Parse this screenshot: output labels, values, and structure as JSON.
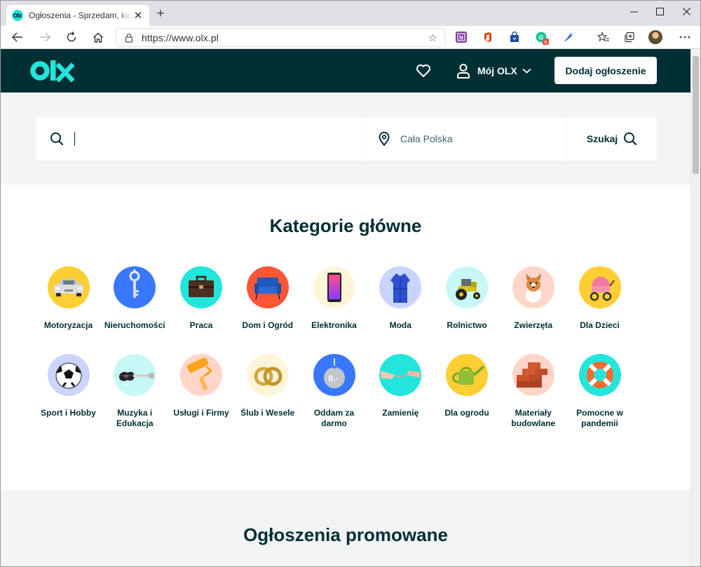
{
  "browser": {
    "tab_title": "Ogłoszenia - Sprzedam, kupię na",
    "tab_close": "✕",
    "new_tab": "+",
    "url": "https://www.olx.pl",
    "extension_badge": "6"
  },
  "header": {
    "logo_text": "olx",
    "account_label": "Mój OLX",
    "add_button": "Dodaj ogłoszenie",
    "colors": {
      "background": "#002f34",
      "logo": "#23e5db"
    }
  },
  "search": {
    "query_value": "",
    "location": "Cała Polska",
    "submit_label": "Szukaj"
  },
  "categories": {
    "title": "Kategorie główne",
    "items": [
      {
        "label": "Motoryzacja",
        "color": "#ffce32",
        "icon": "car-icon"
      },
      {
        "label": "Nieruchomości",
        "color": "#3a77ff",
        "icon": "key-icon"
      },
      {
        "label": "Praca",
        "color": "#23e5db",
        "icon": "briefcase-icon"
      },
      {
        "label": "Dom i Ogród",
        "color": "#ff5636",
        "icon": "armchair-icon"
      },
      {
        "label": "Elektronika",
        "color": "#fff6d9",
        "icon": "smartphone-icon"
      },
      {
        "label": "Moda",
        "color": "#cad5ff",
        "icon": "dress-icon"
      },
      {
        "label": "Rolnictwo",
        "color": "#c8f8f6",
        "icon": "tractor-icon"
      },
      {
        "label": "Zwierzęta",
        "color": "#ffd6c9",
        "icon": "dog-icon"
      },
      {
        "label": "Dla Dzieci",
        "color": "#ffce32",
        "icon": "stroller-icon"
      },
      {
        "label": "Sport i Hobby",
        "color": "#cad5ff",
        "icon": "football-icon"
      },
      {
        "label": "Muzyka i Edukacja",
        "color": "#c8f8f6",
        "icon": "guitar-icon"
      },
      {
        "label": "Usługi i Firmy",
        "color": "#ffd6c9",
        "icon": "paint-roller-icon"
      },
      {
        "label": "Ślub i Wesele",
        "color": "#fff6d9",
        "icon": "rings-icon"
      },
      {
        "label": "Oddam za darmo",
        "color": "#3a77ff",
        "icon": "free-tag-icon"
      },
      {
        "label": "Zamienię",
        "color": "#23e5db",
        "icon": "handshake-icon"
      },
      {
        "label": "Dla ogrodu",
        "color": "#ffce32",
        "icon": "watering-can-icon"
      },
      {
        "label": "Materiały budowlane",
        "color": "#ffd6c9",
        "icon": "bricks-icon"
      },
      {
        "label": "Pomocne w pandemii",
        "color": "#23e5db",
        "icon": "lifebuoy-icon"
      }
    ]
  },
  "free_tag_text": "0.-",
  "promoted": {
    "title": "Ogłoszenia promowane"
  }
}
